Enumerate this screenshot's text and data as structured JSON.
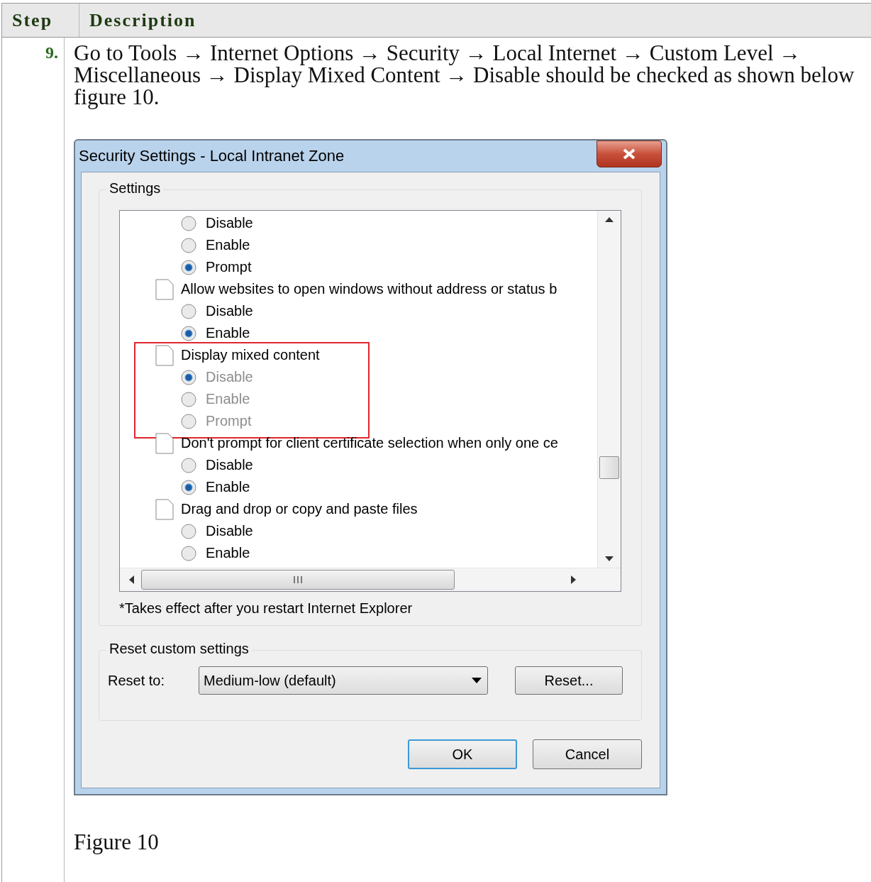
{
  "table": {
    "columns": [
      "Step",
      "Description"
    ],
    "rows": [
      {
        "step": "9.",
        "description": "Go to Tools → Internet Options → Security → Local Internet → Custom Level → Miscellaneous → Display Mixed Content → Disable should be checked as shown below figure 10.",
        "dialog": {
          "title": "Security Settings - Local Intranet Zone",
          "settings_label": "Settings",
          "settings": [
            {
              "highlighted": false,
              "children": [
                {
                  "label": "Disable",
                  "selected": false,
                  "disabled": false
                },
                {
                  "label": "Enable",
                  "selected": false,
                  "disabled": false
                },
                {
                  "label": "Prompt",
                  "selected": true,
                  "disabled": false
                }
              ]
            },
            {
              "label": "Allow websites to open windows without address or status b",
              "highlighted": false,
              "children": [
                {
                  "label": "Disable",
                  "selected": false,
                  "disabled": false
                },
                {
                  "label": "Enable",
                  "selected": true,
                  "disabled": false
                }
              ]
            },
            {
              "label": "Display mixed content",
              "highlighted": true,
              "children": [
                {
                  "label": "Disable",
                  "selected": true,
                  "disabled": true
                },
                {
                  "label": "Enable",
                  "selected": false,
                  "disabled": true
                },
                {
                  "label": "Prompt",
                  "selected": false,
                  "disabled": true
                }
              ]
            },
            {
              "label": "Don't prompt for client certificate selection when only one ce",
              "highlighted": false,
              "children": [
                {
                  "label": "Disable",
                  "selected": false,
                  "disabled": false
                },
                {
                  "label": "Enable",
                  "selected": true,
                  "disabled": false
                }
              ]
            },
            {
              "label": "Drag and drop or copy and paste files",
              "highlighted": false,
              "children": [
                {
                  "label": "Disable",
                  "selected": false,
                  "disabled": false
                },
                {
                  "label": "Enable",
                  "selected": false,
                  "disabled": false
                }
              ]
            }
          ],
          "note": "*Takes effect after you restart Internet Explorer",
          "reset_group_label": "Reset custom settings",
          "reset_to_label": "Reset to:",
          "reset_to_value": "Medium-low (default)",
          "reset_button": "Reset...",
          "buttons": [
            "OK",
            "Cancel"
          ]
        },
        "caption": "Figure 10"
      }
    ]
  }
}
